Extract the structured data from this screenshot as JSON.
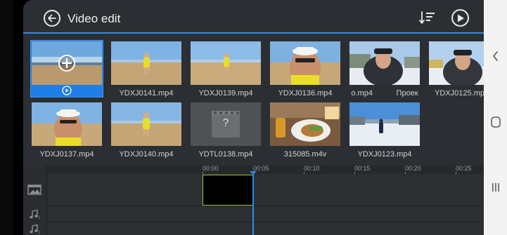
{
  "header": {
    "title": "Video edit",
    "back_icon": "arrow-left-icon",
    "sort_icon": "sort-icon",
    "play_icon": "play-icon"
  },
  "media": {
    "row1": [
      {
        "name": "",
        "selected": true,
        "add_icon": "plus-icon",
        "preview_icon": "play-icon"
      },
      {
        "name": "YDXJ0141.mp4"
      },
      {
        "name": "YDXJ0139.mp4"
      },
      {
        "name": "YDXJ0136.mp4"
      },
      {
        "name": "o.mp4           Проек"
      },
      {
        "name": "YDXJ0125.mp"
      }
    ],
    "row2": [
      {
        "name": "YDXJ0137.mp4"
      },
      {
        "name": "YDXJ0140.mp4"
      },
      {
        "name": "YDTL0138.mp4",
        "placeholder": "?"
      },
      {
        "name": "315085.m4v"
      },
      {
        "name": "YDXJ0123.mp4"
      }
    ]
  },
  "timeline": {
    "ticks": [
      "00:00",
      "00:05",
      "00:10",
      "00:15",
      "00:20",
      "00:25"
    ],
    "tracks": [
      {
        "icon": "image-track-icon"
      },
      {
        "icon": "music-track-1-icon"
      },
      {
        "icon": "music-track-2-icon"
      }
    ]
  },
  "system_nav": {
    "back": "chevron-left-icon",
    "home": "home-icon",
    "recents": "recents-icon"
  },
  "colors": {
    "accent": "#2f89ee",
    "background": "#2b2e32",
    "clip_border": "#9ec13a"
  }
}
